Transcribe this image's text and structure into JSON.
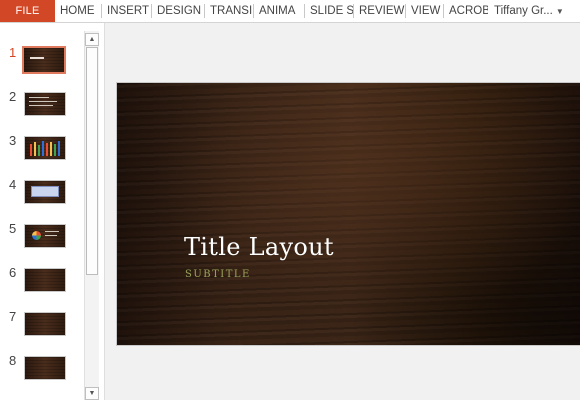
{
  "ribbon": {
    "file_label": "FILE",
    "tabs": [
      "HOME",
      "INSERT",
      "DESIGN",
      "TRANSI",
      "ANIMA",
      "SLIDE S",
      "REVIEW",
      "VIEW",
      "ACROB"
    ],
    "user_name": "Tiffany Gr..."
  },
  "thumbnails": {
    "numbers": [
      "1",
      "2",
      "3",
      "4",
      "5",
      "6",
      "7",
      "8"
    ],
    "active_slide": "1"
  },
  "slide": {
    "title": "Title Layout",
    "subtitle": "SUBTITLE"
  },
  "colors": {
    "file_tab": "#d24726",
    "active_thumb_border": "#e07a5f",
    "subtitle": "#9aa55a"
  },
  "icons": {
    "scroll_up": "scroll-up-arrow-icon",
    "scroll_down": "scroll-down-arrow-icon",
    "user_dropdown": "chevron-down-icon"
  }
}
